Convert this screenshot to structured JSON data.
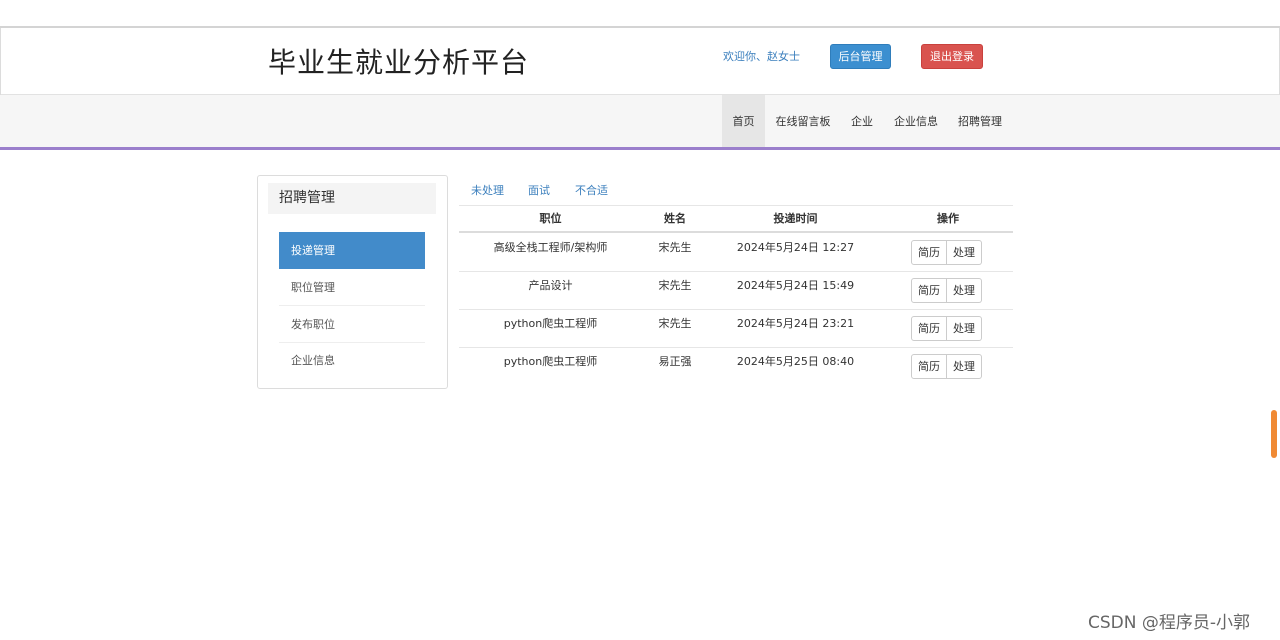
{
  "header": {
    "brand": "毕业生就业分析平台",
    "welcome": "欢迎你、赵女士",
    "admin_button": "后台管理",
    "logout_button": "退出登录"
  },
  "nav": {
    "items": [
      {
        "label": "首页",
        "active": true
      },
      {
        "label": "在线留言板",
        "active": false
      },
      {
        "label": "企业",
        "active": false
      },
      {
        "label": "企业信息",
        "active": false
      },
      {
        "label": "招聘管理",
        "active": false
      }
    ]
  },
  "sidebar": {
    "title": "招聘管理",
    "items": [
      {
        "label": "投递管理",
        "active": true
      },
      {
        "label": "职位管理",
        "active": false
      },
      {
        "label": "发布职位",
        "active": false
      },
      {
        "label": "企业信息",
        "active": false
      }
    ]
  },
  "tabs": [
    "未处理",
    "面试",
    "不合适"
  ],
  "table": {
    "headers": [
      "职位",
      "姓名",
      "投递时间",
      "操作"
    ],
    "rows": [
      {
        "position": "高级全栈工程师/架构师",
        "name": "宋先生",
        "time": "2024年5月24日 12:27"
      },
      {
        "position": "产品设计",
        "name": "宋先生",
        "time": "2024年5月24日 15:49"
      },
      {
        "position": "python爬虫工程师",
        "name": "宋先生",
        "time": "2024年5月24日 23:21"
      },
      {
        "position": "python爬虫工程师",
        "name": "易正强",
        "time": "2024年5月25日 08:40"
      }
    ],
    "actions": {
      "resume": "简历",
      "process": "处理"
    }
  },
  "watermark": "CSDN @程序员-小郭",
  "colors": {
    "primary": "#428bca",
    "danger": "#d9534f",
    "nav_underline": "#9b7fcc",
    "link": "#3b7fbd"
  }
}
